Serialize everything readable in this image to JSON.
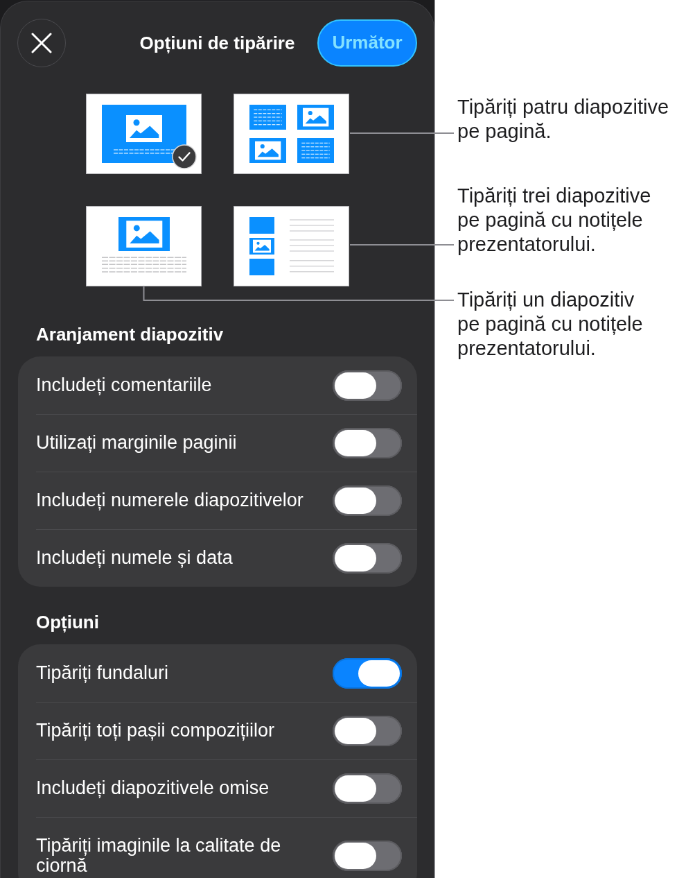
{
  "header": {
    "title": "Opțiuni de tipărire",
    "next_button": "Următor"
  },
  "layouts": [
    {
      "kind": "single",
      "selected": true
    },
    {
      "kind": "grid",
      "selected": false
    },
    {
      "kind": "notes",
      "selected": false
    },
    {
      "kind": "handout",
      "selected": false
    }
  ],
  "callouts": [
    "Tipăriți patru diapozitive\npe pagină.",
    "Tipăriți trei diapozitive\npe pagină cu notițele\nprezentatorului.",
    "Tipăriți un diapozitiv\npe pagină cu notițele\nprezentatorului."
  ],
  "sections": [
    {
      "title": "Aranjament diapozitiv",
      "rows": [
        {
          "label": "Includeți comentariile",
          "on": false
        },
        {
          "label": "Utilizați marginile paginii",
          "on": false
        },
        {
          "label": "Includeți numerele diapozitivelor",
          "on": false
        },
        {
          "label": "Includeți numele și data",
          "on": false
        }
      ]
    },
    {
      "title": "Opțiuni",
      "rows": [
        {
          "label": "Tipăriți fundaluri",
          "on": true
        },
        {
          "label": "Tipăriți toți pașii compozițiilor",
          "on": false
        },
        {
          "label": "Includeți diapozitivele omise",
          "on": false
        },
        {
          "label": "Tipăriți imaginile la calitate de ciornă",
          "on": false
        }
      ]
    }
  ]
}
